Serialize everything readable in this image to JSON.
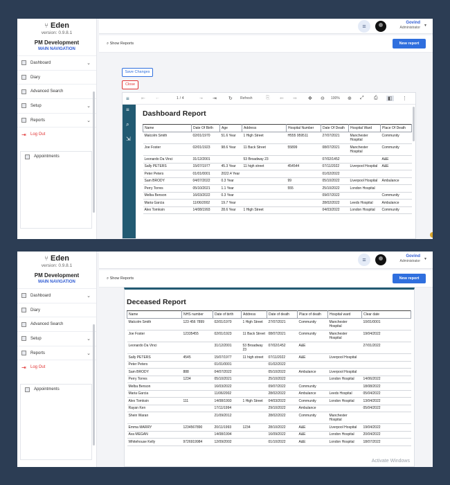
{
  "app": {
    "name": "Eden",
    "version": "version: 0.9.8.1"
  },
  "org": {
    "name": "PM Development",
    "nav_label": "MAIN NAVIGATION"
  },
  "sidebar": {
    "items": [
      {
        "label": "Dashboard",
        "icon": "dashboard-icon"
      },
      {
        "label": "Diary",
        "icon": "diary-icon"
      },
      {
        "label": "Advanced Search",
        "icon": "search-icon"
      },
      {
        "label": "Setup",
        "icon": "setup-icon"
      },
      {
        "label": "Reports",
        "icon": "reports-icon"
      },
      {
        "label": "Log Out",
        "icon": "logout-icon"
      }
    ],
    "appointments": "Appointments"
  },
  "user": {
    "name": "Govind",
    "role": "Administrator"
  },
  "toolbar": {
    "show_reports": "Show Reports",
    "new_report": "New report",
    "save_changes": "Save Changes",
    "close": "Close"
  },
  "viewer": {
    "page_indicator": "1 / 4",
    "refresh": "Refresh",
    "zoom": "100%"
  },
  "dashboard": {
    "title": "Dashboard Report",
    "columns": [
      "Name",
      "Date Of Birth",
      "Age",
      "Address",
      "Hospital Number",
      "Date Of Death",
      "Hospital Ward",
      "Place Of Death"
    ],
    "rows": [
      [
        "Malcolm Smith",
        "02/01/1970",
        "51.6 Year",
        "1 High Street",
        "H555 959511",
        "27/07/2021",
        "Manchester Hospital",
        "Community"
      ],
      [
        "Joe Foster",
        "02/01/1923",
        "98.6 Year",
        "11 Back Street",
        "55899",
        "08/07/2021",
        "Manchester Hospital",
        "Community"
      ],
      [
        "Leonardo Da Vinci",
        "31/12/2001",
        "",
        "53 Broadway 23",
        "",
        "07/02/1452",
        "",
        "A&E"
      ],
      [
        "Sally PETERS",
        "15/07/1977",
        "45.3 Year",
        "11 high street",
        "454544",
        "07/11/2022",
        "Liverpool Hospital",
        "A&E"
      ],
      [
        "Peter Peters",
        "01/01/0001",
        "2022.4 Year",
        "",
        "",
        "01/02/2022",
        "",
        ""
      ],
      [
        "Sam BRODY",
        "04/07/2022",
        "0.3 Year",
        "",
        "99",
        "05/10/2022",
        "Liverpool Hospital",
        "Ambulance"
      ],
      [
        "Perry Torres",
        "05/10/2021",
        "1.1 Year",
        "",
        "555",
        "25/10/2022",
        "London Hospital",
        ""
      ],
      [
        "Melba Benson",
        "16/03/2022",
        "0.3 Year",
        "",
        "",
        "09/07/2022",
        "",
        "Community"
      ],
      [
        "Maria Garcia",
        "11/06/2002",
        "19.7 Year",
        "",
        "",
        "28/02/2022",
        "Leeds Hospital",
        "Ambulance"
      ],
      [
        "Alex Tomksin",
        "14/08/1993",
        "28.6 Year",
        "1 High Street",
        "",
        "04/03/2022",
        "London Hospital",
        "Community"
      ]
    ]
  },
  "deceased": {
    "title": "Deceased Report",
    "columns": [
      "Name",
      "NHS number",
      "Date of birth",
      "Address",
      "Date of death",
      "Place of death",
      "Hospital ward",
      "Clear date"
    ],
    "rows": [
      [
        "Malcolm Smith",
        "123 456 7899",
        "02/01/1970",
        "1 High Street",
        "27/07/2021",
        "Community",
        "Manchester Hospital",
        "10/01/0001"
      ],
      [
        "Joe Foster",
        "12335455",
        "02/01/1923",
        "11 Back Street",
        "08/07/2021",
        "Community",
        "Manchester Hospital",
        "19/04/2022"
      ],
      [
        "Leonardo Da Vinci",
        "",
        "31/12/2001",
        "53 Broadway 23",
        "07/02/1452",
        "A&E",
        "",
        "27/01/2022"
      ],
      [
        "Sally PETERS",
        "4545",
        "15/07/1977",
        "11 high street",
        "07/11/2022",
        "A&E",
        "Liverpool Hospital",
        ""
      ],
      [
        "Peter Peters",
        "",
        "01/01/0001",
        "",
        "01/02/2022",
        "",
        "",
        ""
      ],
      [
        "Sam BRODY",
        "888",
        "04/07/2022",
        "",
        "05/10/2022",
        "Ambulance",
        "Liverpool Hospital",
        ""
      ],
      [
        "Perry Torres",
        "1234",
        "05/10/2021",
        "",
        "25/10/2022",
        "",
        "London Hospital",
        "14/06/2022"
      ],
      [
        "Melba Benson",
        "",
        "16/03/2022",
        "",
        "09/07/2022",
        "Community",
        "",
        "18/08/2022"
      ],
      [
        "Maria Garcia",
        "",
        "11/06/2002",
        "",
        "28/02/2022",
        "Ambulance",
        "Leeds Hospital",
        "05/04/2022"
      ],
      [
        "Alex Tomksin",
        "111",
        "14/08/1993",
        "1 High Street",
        "04/03/2022",
        "Community",
        "London Hospital",
        "13/04/2022"
      ],
      [
        "Rayan Ken",
        "",
        "17/11/1994",
        "",
        "29/10/2022",
        "Ambulance",
        "",
        "05/04/2022"
      ],
      [
        "Shein Waran",
        "",
        "21/09/2012",
        "",
        "28/02/2022",
        "Community",
        "Manchester Hospital",
        ""
      ],
      [
        "Emma MARRY",
        "1234567890",
        "20/11/1993",
        "1234",
        "28/10/2022",
        "A&E",
        "Liverpool Hospital",
        "19/04/2022"
      ],
      [
        "Ava MEGAN",
        "",
        "14/08/1994",
        "",
        "16/09/2022",
        "A&E",
        "London Hospital",
        "20/04/2022"
      ],
      [
        "Whitehouse Kelly",
        "9726919984",
        "12/09/2002",
        "",
        "01/10/2022",
        "A&E",
        "London Hospital",
        "18/07/2022"
      ]
    ]
  },
  "watermark": "Activate Windows"
}
